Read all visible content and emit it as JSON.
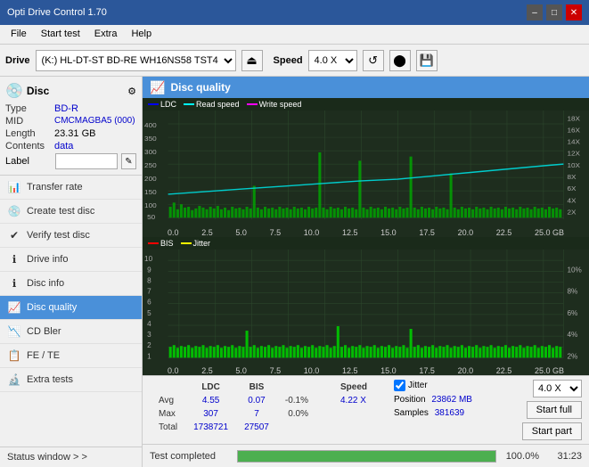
{
  "titlebar": {
    "title": "Opti Drive Control 1.70",
    "minimize": "–",
    "maximize": "□",
    "close": "✕"
  },
  "menubar": {
    "items": [
      "File",
      "Start test",
      "Extra",
      "Help"
    ]
  },
  "drivebar": {
    "label": "Drive",
    "drive_value": "(K:)  HL-DT-ST BD-RE  WH16NS58 TST4",
    "eject_icon": "⏏",
    "speed_label": "Speed",
    "speed_value": "4.0 X",
    "icon1": "🔄",
    "icon2": "💾",
    "icon3": "📋"
  },
  "disc_panel": {
    "type_label": "Type",
    "type_value": "BD-R",
    "mid_label": "MID",
    "mid_value": "CMCMAGBA5 (000)",
    "length_label": "Length",
    "length_value": "23.31 GB",
    "contents_label": "Contents",
    "contents_value": "data",
    "label_label": "Label",
    "label_value": ""
  },
  "nav": {
    "items": [
      {
        "id": "transfer-rate",
        "label": "Transfer rate",
        "active": false
      },
      {
        "id": "create-test-disc",
        "label": "Create test disc",
        "active": false
      },
      {
        "id": "verify-test-disc",
        "label": "Verify test disc",
        "active": false
      },
      {
        "id": "drive-info",
        "label": "Drive info",
        "active": false
      },
      {
        "id": "disc-info",
        "label": "Disc info",
        "active": false
      },
      {
        "id": "disc-quality",
        "label": "Disc quality",
        "active": true
      },
      {
        "id": "cd-bler",
        "label": "CD Bler",
        "active": false
      },
      {
        "id": "fe-te",
        "label": "FE / TE",
        "active": false
      },
      {
        "id": "extra-tests",
        "label": "Extra tests",
        "active": false
      }
    ],
    "status_window": "Status window > >"
  },
  "content": {
    "title": "Disc quality",
    "chart1": {
      "legend": [
        "LDC",
        "Read speed",
        "Write speed"
      ],
      "y_left": [
        "400",
        "350",
        "300",
        "250",
        "200",
        "150",
        "100",
        "50"
      ],
      "y_right": [
        "18X",
        "16X",
        "14X",
        "12X",
        "10X",
        "8X",
        "6X",
        "4X",
        "2X"
      ],
      "x_axis": [
        "0.0",
        "2.5",
        "5.0",
        "7.5",
        "10.0",
        "12.5",
        "15.0",
        "17.5",
        "20.0",
        "22.5",
        "25.0 GB"
      ]
    },
    "chart2": {
      "legend": [
        "BIS",
        "Jitter"
      ],
      "y_left": [
        "10",
        "9",
        "8",
        "7",
        "6",
        "5",
        "4",
        "3",
        "2",
        "1"
      ],
      "y_right": [
        "10%",
        "8%",
        "6%",
        "4%",
        "2%"
      ],
      "x_axis": [
        "0.0",
        "2.5",
        "5.0",
        "7.5",
        "10.0",
        "12.5",
        "15.0",
        "17.5",
        "20.0",
        "22.5",
        "25.0 GB"
      ]
    }
  },
  "stats": {
    "headers": [
      "",
      "LDC",
      "BIS",
      "",
      "Jitter",
      "Speed"
    ],
    "avg_label": "Avg",
    "avg_ldc": "4.55",
    "avg_bis": "0.07",
    "avg_jitter": "-0.1%",
    "max_label": "Max",
    "max_ldc": "307",
    "max_bis": "7",
    "max_jitter": "0.0%",
    "total_label": "Total",
    "total_ldc": "1738721",
    "total_bis": "27507",
    "jitter_checked": true,
    "jitter_label": "Jitter",
    "speed_label": "Speed",
    "speed_value": "4.22 X",
    "speed_select": "4.0 X",
    "position_label": "Position",
    "position_value": "23862 MB",
    "samples_label": "Samples",
    "samples_value": "381639",
    "btn_start_full": "Start full",
    "btn_start_part": "Start part"
  },
  "progressbar": {
    "label": "Test completed",
    "percent": "100.0%",
    "time": "31:23"
  }
}
